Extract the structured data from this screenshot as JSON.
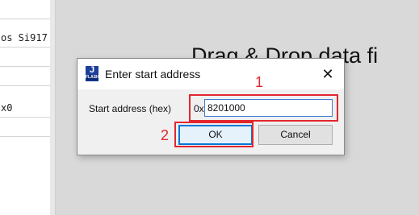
{
  "background": {
    "left_rows": [
      "os Si917",
      "",
      "",
      "x0",
      ""
    ],
    "drop_hint": "Drag & Drop data fi"
  },
  "dialog": {
    "title": "Enter start address",
    "app_icon_text": "J",
    "app_icon_subtext": "FLASH",
    "close_glyph": "✕",
    "field_label": "Start address (hex)",
    "hex_prefix": "0x",
    "address_value": "8201000",
    "ok_label": "OK",
    "cancel_label": "Cancel"
  },
  "annotations": {
    "step1": "1",
    "step2": "2",
    "color": "#e3262e"
  }
}
